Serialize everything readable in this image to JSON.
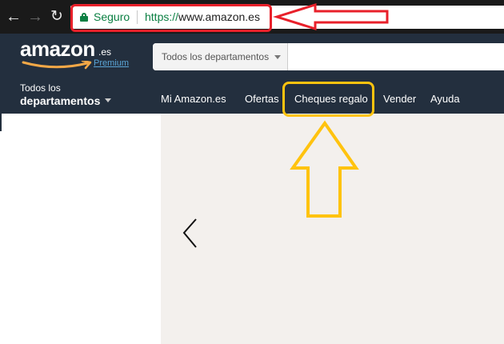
{
  "browser": {
    "security_label": "Seguro",
    "url_scheme": "https://",
    "url_host": "www.amazon.es",
    "icons": [
      "back-arrow-icon",
      "forward-arrow-icon",
      "reload-icon",
      "lock-icon"
    ]
  },
  "amazon": {
    "logo": {
      "word": "amazon",
      "tld": ".es",
      "subtitle": "Premium"
    },
    "search": {
      "department": "Todos los departamentos",
      "placeholder": ""
    },
    "nav": {
      "all_departments_line1": "Todos los",
      "all_departments_line2": "departamentos",
      "links": [
        "Mi Amazon.es",
        "Ofertas",
        "Cheques regalo",
        "Vender",
        "Ayuda"
      ]
    }
  },
  "colors": {
    "chrome_dark": "#1a1a1a",
    "amazon_navy": "#232f3e",
    "secure_green": "#0b8043",
    "annotation_red": "#e8202a",
    "annotation_yellow": "#ffc30f",
    "amazon_orange": "#f3a847",
    "hero_background": "#f3f0ed"
  }
}
